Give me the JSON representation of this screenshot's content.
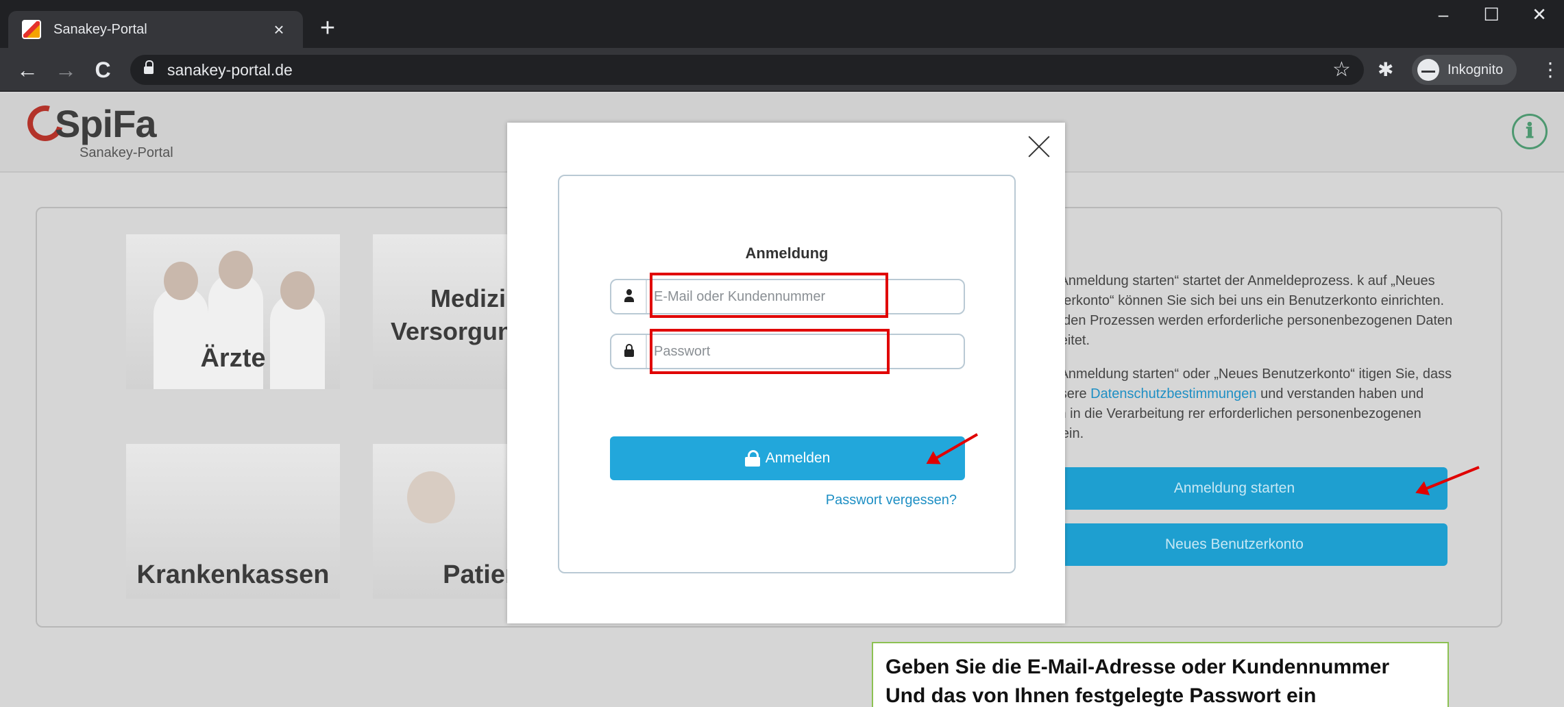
{
  "browser": {
    "tab_title": "Sanakey-Portal",
    "tab_close": "×",
    "new_tab": "+",
    "url": "sanakey-portal.de",
    "incognito_label": "Inkognito",
    "window_controls": {
      "minimize": "–",
      "maximize": "☐",
      "close": "✕"
    }
  },
  "header": {
    "logo_text": "SpiFa",
    "logo_subtitle": "Sanakey-Portal",
    "info_icon": "ℹ"
  },
  "tiles": [
    {
      "label": "Ärzte"
    },
    {
      "label": "Medizinis Versorgungs n"
    },
    {
      "label": "Krankenkassen"
    },
    {
      "label": "Patiente"
    }
  ],
  "right_panel": {
    "paragraph1": "k auf „Anmeldung starten“ startet der Anmeldeprozess. k auf „Neues Benutzerkonto“ können Sie sich bei uns ein Benutzerkonto einrichten. Bei beiden Prozessen werden erforderliche personenbezogenen Daten verarbeitet.",
    "paragraph2_pre": "k auf „Anmeldung starten“ oder „Neues Benutzerkonto“ itigen Sie, dass Sie unsere ",
    "paragraph2_link": "Datenschutzbestimmungen",
    "paragraph2_post": " und verstanden haben und willigen in die Verarbeitung rer erforderlichen personenbezogenen Daten ein.",
    "start_button": "Anmeldung starten",
    "register_button": "Neues Benutzerkonto"
  },
  "modal": {
    "title": "Anmeldung",
    "email_placeholder": "E-Mail oder Kundennummer",
    "password_placeholder": "Passwort",
    "login_button": "Anmelden",
    "forgot_link": "Passwort vergessen?"
  },
  "callout": {
    "line1": "Geben Sie die E-Mail-Adresse oder Kundennummer",
    "line2": "Und das von Ihnen festgelegte Passwort ein"
  },
  "colors": {
    "accent": "#22a7db",
    "highlight": "#e00000",
    "callout_border": "#8cc152"
  }
}
